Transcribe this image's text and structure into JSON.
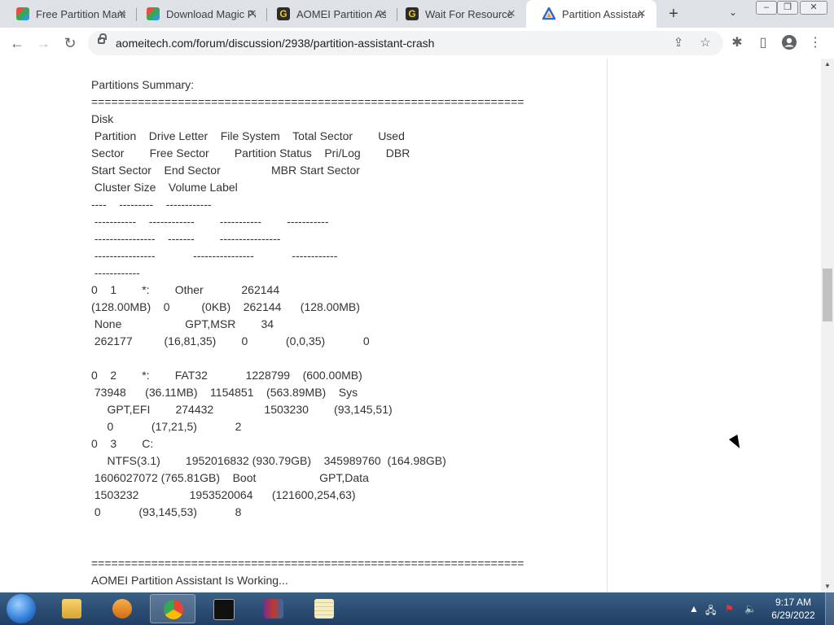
{
  "browser": {
    "tabs": [
      {
        "title": "Free Partition Mana",
        "color": "#2e9bd6"
      },
      {
        "title": "Download Magic Pa",
        "color": "#2e9bd6"
      },
      {
        "title": "AOMEI Partition As",
        "color": "#333333"
      },
      {
        "title": "Wait For Resource",
        "color": "#333333"
      },
      {
        "title": "Partition Assistant",
        "color": "#2a6ad6"
      }
    ],
    "new_tab": "+",
    "url": "aomeitech.com/forum/discussion/2938/partition-assistant-crash"
  },
  "post": {
    "lines": [
      "Partitions Summary:",
      "=================================================================",
      "Disk",
      " Partition    Drive Letter    File System    Total Sector        Used",
      "Sector        Free Sector        Partition Status    Pri/Log        DBR",
      "Start Sector    End Sector                MBR Start Sector",
      " Cluster Size    Volume Label",
      "----    ---------    ------------",
      " -----------    ------------        -----------        -----------",
      " ----------------    -------        ----------------",
      " ----------------            ----------------            ------------",
      " ------------",
      "0    1        *:        Other            262144",
      "(128.00MB)    0          (0KB)    262144      (128.00MB)",
      " None                    GPT,MSR        34",
      " 262177          (16,81,35)        0            (0,0,35)            0",
      "",
      "0    2        *:        FAT32            1228799    (600.00MB)",
      " 73948      (36.11MB)    1154851    (563.89MB)    Sys",
      "     GPT,EFI        274432                1503230        (93,145,51)",
      "     0            (17,21,5)            2",
      "0    3        C:",
      "     NTFS(3.1)        1952016832 (930.79GB)    345989760  (164.98GB)",
      " 1606027072 (765.81GB)    Boot                    GPT,Data",
      " 1503232                1953520064      (121600,254,63)",
      " 0            (93,145,53)            8",
      "",
      "",
      "=================================================================",
      "AOMEI Partition Assistant Is Working..."
    ]
  },
  "taskbar": {
    "time": "9:17 AM",
    "date": "6/29/2022"
  }
}
